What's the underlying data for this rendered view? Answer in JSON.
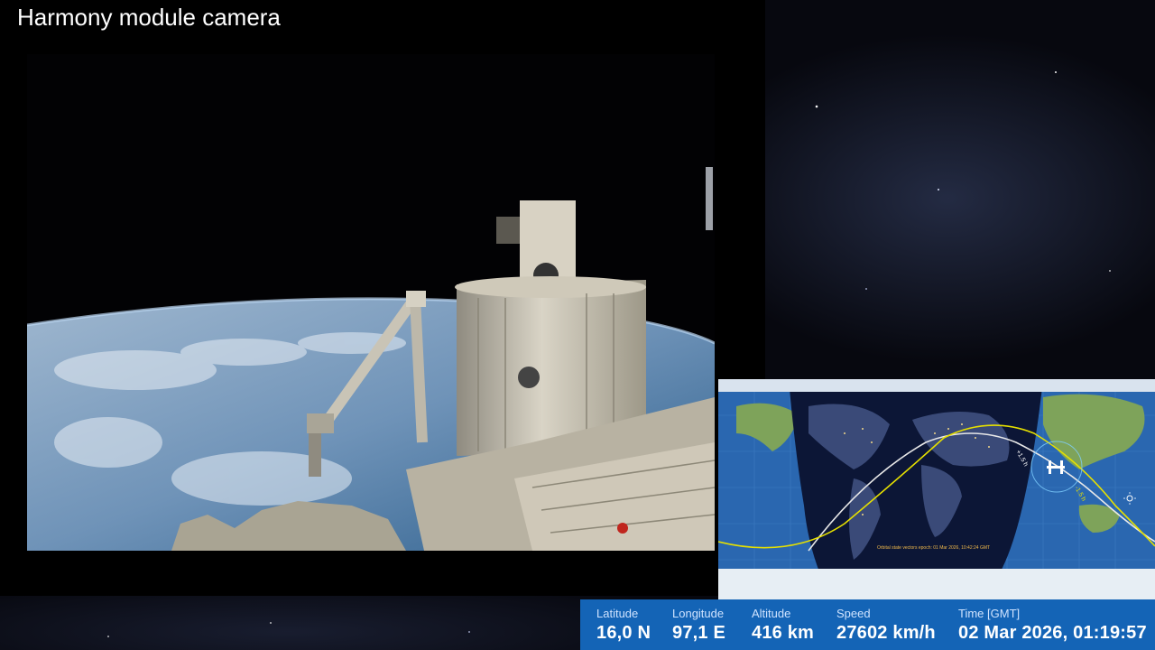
{
  "title": "Harmony module camera",
  "map": {
    "epoch_note": "Orbital state vectors epoch: 01 Mar 2026, 10:42:24 GMT",
    "marker_plus": "+1.5 h",
    "marker_minus": "-1.5 h"
  },
  "telemetry": {
    "latitude": {
      "label": "Latitude",
      "value": "16,0 N"
    },
    "longitude": {
      "label": "Longitude",
      "value": "97,1 E"
    },
    "altitude": {
      "label": "Altitude",
      "value": "416 km"
    },
    "speed": {
      "label": "Speed",
      "value": "27602 km/h"
    },
    "time": {
      "label": "Time [GMT]",
      "value": "02 Mar 2026, 01:19:57"
    }
  },
  "colors": {
    "telemetry_bar": "#1464b6",
    "orbit_future": "#e8e8e8",
    "orbit_past": "#e6e000",
    "ocean": "#2a67b0"
  }
}
